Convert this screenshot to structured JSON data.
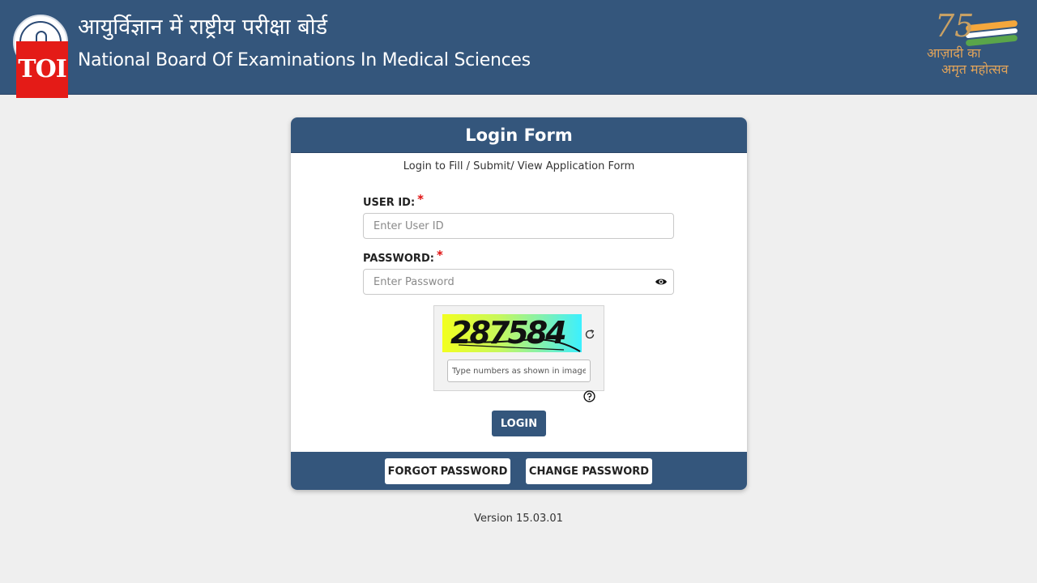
{
  "header": {
    "hindi_title": "आयुर्विज्ञान में राष्ट्रीय परीक्षा बोर्ड",
    "english_title": "National Board Of Examinations In Medical Sciences",
    "watermark": "TOI",
    "azadi": {
      "number": "75",
      "line1": "आज़ादी का",
      "line2": "अमृत महोत्सव"
    },
    "colors": {
      "bar": "#34567c",
      "toi_red": "#e41b17"
    }
  },
  "form": {
    "title": "Login Form",
    "subtitle": "Login to Fill / Submit/ View Application Form",
    "user_id": {
      "label": "USER ID:",
      "required_mark": "*",
      "placeholder": "Enter User ID",
      "value": ""
    },
    "password": {
      "label": "PASSWORD:",
      "required_mark": "*",
      "placeholder": "Enter Password",
      "value": ""
    },
    "captcha": {
      "code": "287584",
      "input_placeholder": "Type numbers as shown in image",
      "input_value": ""
    },
    "login_label": "LOGIN",
    "forgot_label": "FORGOT PASSWORD",
    "change_label": "CHANGE PASSWORD"
  },
  "icons": {
    "show_password": "eye-icon",
    "refresh_captcha": "refresh-icon",
    "captcha_help": "help-icon"
  },
  "version": "Version 15.03.01"
}
